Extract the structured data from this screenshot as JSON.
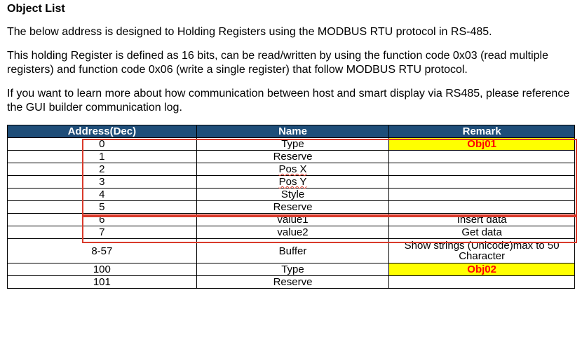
{
  "heading": "Object List",
  "paragraphs": {
    "p1": "The below address is designed to Holding Registers using the MODBUS RTU protocol in RS-485.",
    "p2": "This holding Register is defined as 16 bits, can be read/written by using the function code 0x03 (read multiple registers) and function code 0x06 (write a single register) that follow MODBUS RTU protocol.",
    "p3": "If you want to learn more about how communication between host and smart display via RS485, please reference the GUI builder communication log."
  },
  "table": {
    "headers": {
      "address": "Address(Dec)",
      "name": "Name",
      "remark": "Remark"
    },
    "rows": [
      {
        "address": "0",
        "name": "Type",
        "remark": "Obj01",
        "remark_yellow": true
      },
      {
        "address": "1",
        "name": "Reserve",
        "remark": ""
      },
      {
        "address": "2",
        "name": "Pos X",
        "remark": "",
        "name_wavy": true
      },
      {
        "address": "3",
        "name": "Pos Y",
        "remark": "",
        "name_wavy": true
      },
      {
        "address": "4",
        "name": "Style",
        "remark": ""
      },
      {
        "address": "5",
        "name": "Reserve",
        "remark": ""
      },
      {
        "address": "6",
        "name": "value1",
        "remark": "Insert data"
      },
      {
        "address": "7",
        "name": "value2",
        "remark": "Get data"
      },
      {
        "address": "8-57",
        "name": "Buffer",
        "remark": "Show strings (Unicode)max to 50 Character",
        "tall": true
      },
      {
        "address": "100",
        "name": "Type",
        "remark": "Obj02",
        "remark_yellow": true
      },
      {
        "address": "101",
        "name": "Reserve",
        "remark": ""
      }
    ]
  }
}
